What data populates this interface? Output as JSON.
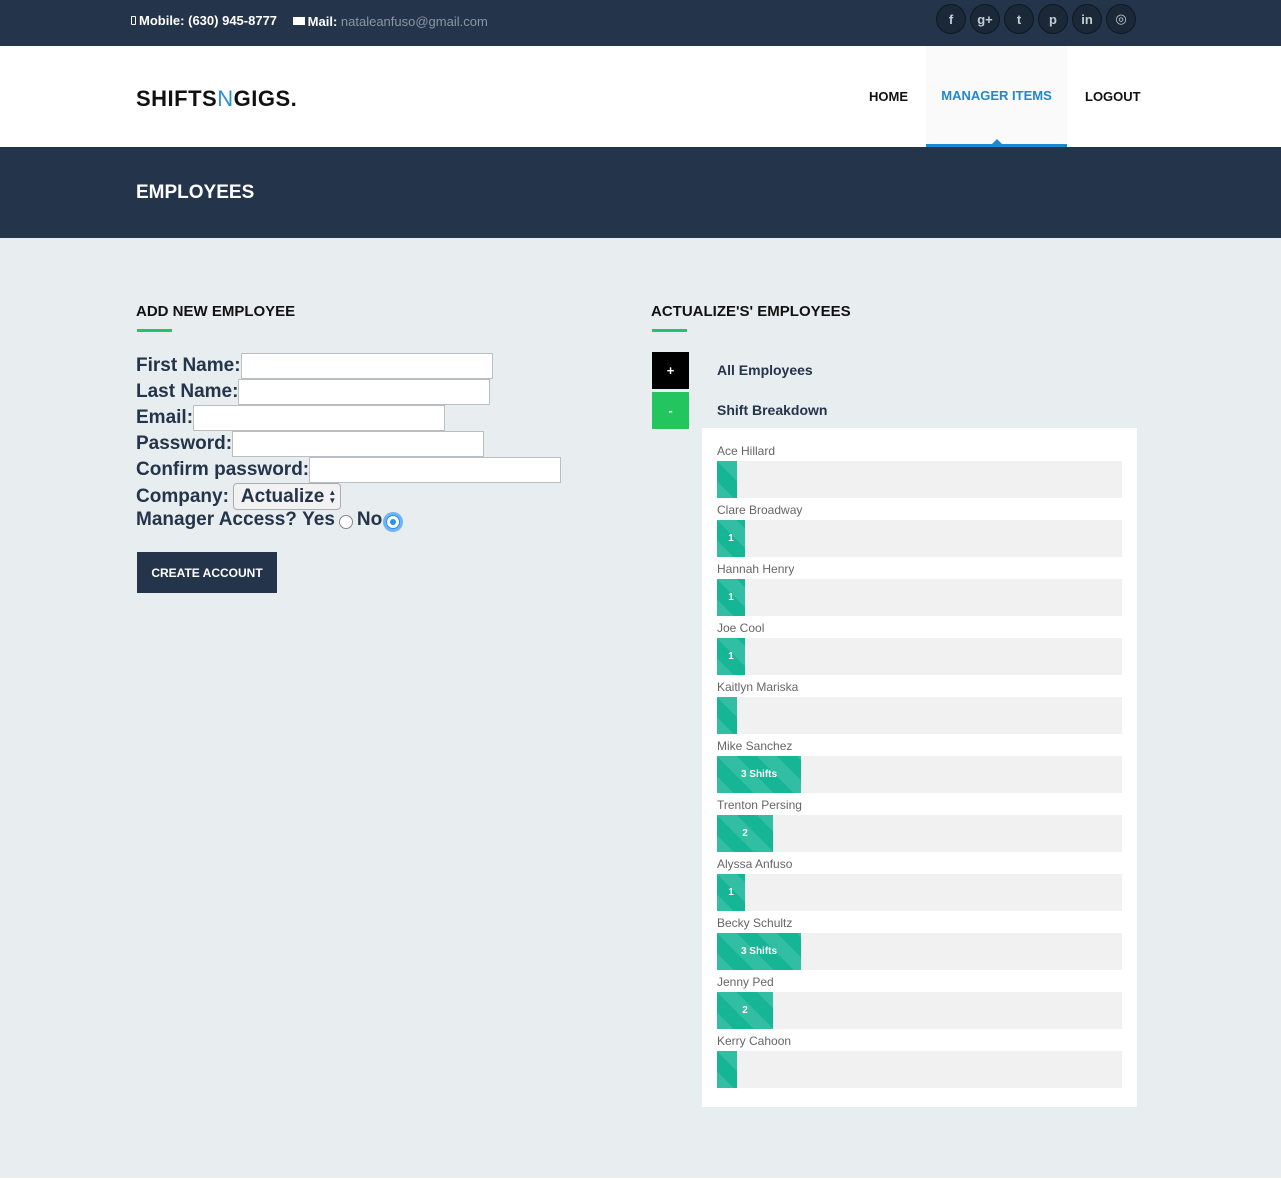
{
  "topbar": {
    "mobile_label": "Mobile:",
    "mobile_value": "(630) 945-8777",
    "mail_label": "Mail:",
    "mail_value": "nataleanfuso@gmail.com",
    "socials": [
      {
        "icon": "facebook-icon",
        "glyph": "f"
      },
      {
        "icon": "google-plus-icon",
        "glyph": "g+"
      },
      {
        "icon": "twitter-icon",
        "glyph": "t"
      },
      {
        "icon": "pinterest-icon",
        "glyph": "p"
      },
      {
        "icon": "linkedin-icon",
        "glyph": "in"
      },
      {
        "icon": "dribbble-icon",
        "glyph": "◎"
      }
    ]
  },
  "brand": {
    "part1": "SHIFTS",
    "part2": "N",
    "part3": "GIGS."
  },
  "nav": {
    "home": "HOME",
    "manager_items": "MANAGER ITEMS",
    "logout": "LOGOUT"
  },
  "page_title": "EMPLOYEES",
  "form": {
    "title": "ADD NEW EMPLOYEE",
    "first_name_label": "First Name:",
    "last_name_label": "Last Name:",
    "email_label": "Email:",
    "password_label": "Password:",
    "confirm_label": "Confirm password:",
    "company_label": "Company:",
    "company_value": "Actualize",
    "manager_label": "Manager Access?",
    "yes_label": "Yes",
    "no_label": "No",
    "manager_selected": "No",
    "submit_label": "CREATE ACCOUNT"
  },
  "employees_panel": {
    "title": "ACTUALIZE'S' EMPLOYEES",
    "all_toggle": "+",
    "all_label": "All Employees",
    "breakdown_toggle": "-",
    "breakdown_label": "Shift Breakdown",
    "colors": {
      "all": "#000000",
      "breakdown": "#22c55e",
      "bar": "#15b595",
      "track": "#f2f1f1"
    },
    "employees": [
      {
        "name": "Ace Hillard",
        "shifts": 0,
        "label": ""
      },
      {
        "name": "Clare Broadway",
        "shifts": 1,
        "label": "1"
      },
      {
        "name": "Hannah Henry",
        "shifts": 1,
        "label": "1"
      },
      {
        "name": "Joe Cool",
        "shifts": 1,
        "label": "1"
      },
      {
        "name": "Kaitlyn Mariska",
        "shifts": 0,
        "label": ""
      },
      {
        "name": "Mike Sanchez",
        "shifts": 3,
        "label": "3 Shifts"
      },
      {
        "name": "Trenton Persing",
        "shifts": 2,
        "label": "2"
      },
      {
        "name": "Alyssa Anfuso",
        "shifts": 1,
        "label": "1"
      },
      {
        "name": "Becky Schultz",
        "shifts": 3,
        "label": "3 Shifts"
      },
      {
        "name": "Jenny Ped",
        "shifts": 2,
        "label": "2"
      },
      {
        "name": "Kerry Cahoon",
        "shifts": 0,
        "label": ""
      }
    ]
  }
}
